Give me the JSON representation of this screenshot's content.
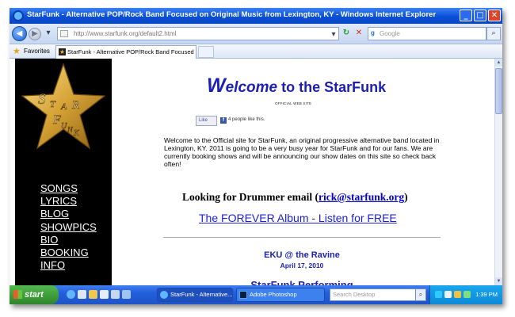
{
  "window": {
    "title": "StarFunk - Alternative POP/Rock Band Focused on Original Music from Lexington, KY - Windows Internet Explorer",
    "min_label": "_",
    "max_label": "□",
    "close_label": "✕"
  },
  "addressbar": {
    "back_label": "◀",
    "forward_label": "▶",
    "url": "http://www.starfunk.org/default2.html",
    "dropdown_label": "▾",
    "refresh_label": "↻",
    "stop_label": "✕",
    "search_placeholder": "Google",
    "search_button_label": "⌕"
  },
  "favorites": {
    "label": "Favorites",
    "tab_title": "StarFunk - Alternative POP/Rock Band Focused on Ori...",
    "tab_icon": "★"
  },
  "sidebar": {
    "logo_letters": [
      "S",
      "T",
      "A",
      "R",
      "F",
      "U",
      "N",
      "K"
    ],
    "nav": [
      "SONGS",
      "LYRICS",
      "BLOG",
      "SHOWPICS",
      "BIO",
      "BOOKING",
      "INFO"
    ]
  },
  "main": {
    "welcome_w": "W",
    "welcome_elcome": "elcome",
    "welcome_rest": " to the StarFunk",
    "official": "OFFICIAL WEB SITE",
    "like_button": "Like",
    "like_count": "4 people like this.",
    "intro": "Welcome to the Official site for StarFunk, an original progressive alternative band located in Lexington, KY. 2011 is going to be a very busy year for StarFunk and for our fans. We are currently booking shows and will be announcing our show dates on this site so check back often!",
    "drummer_prefix": "Looking for Drummer email (",
    "drummer_email": "rick@starfunk.org",
    "drummer_suffix": ")",
    "album_link": "The FOREVER Album - Listen for FREE",
    "event_title": "EKU @ the Ravine",
    "event_date": "April 17, 2010",
    "performing": "StarFunk Performing"
  },
  "taskbar": {
    "start_label": "start",
    "task_ie": "StarFunk - Alternative...",
    "task_ps": "Adobe Photoshop",
    "search_placeholder": "Search Desktop",
    "clock": "1:39 PM"
  },
  "colors": {
    "accent_blue": "#1b1fb4",
    "star_gold": "#d9a93a",
    "sidebar_bg": "#000000"
  }
}
